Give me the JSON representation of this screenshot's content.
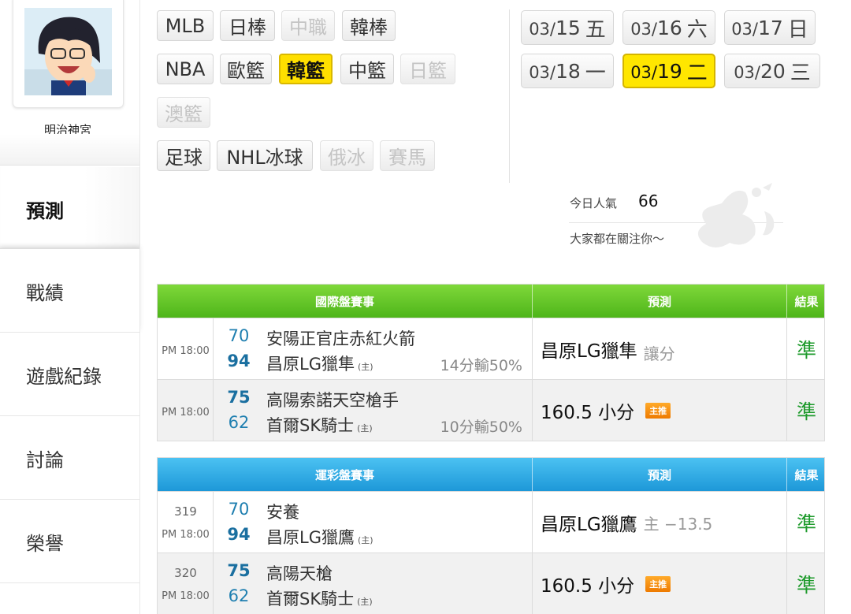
{
  "sidebar": {
    "username": "明治神宮",
    "nav": {
      "predict": "預測",
      "record": "戰績",
      "games": "遊戲紀錄",
      "discuss": "討論",
      "honor": "榮譽"
    }
  },
  "sports": [
    {
      "label": "MLB",
      "state": "normal"
    },
    {
      "label": "日棒",
      "state": "normal"
    },
    {
      "label": "中職",
      "state": "disabled"
    },
    {
      "label": "韓棒",
      "state": "normal"
    },
    {
      "label": "NBA",
      "state": "normal"
    },
    {
      "label": "歐籃",
      "state": "normal"
    },
    {
      "label": "韓籃",
      "state": "active"
    },
    {
      "label": "中籃",
      "state": "normal"
    },
    {
      "label": "日籃",
      "state": "disabled"
    },
    {
      "label": "澳籃",
      "state": "disabled"
    },
    {
      "label": "足球",
      "state": "normal"
    },
    {
      "label": "NHL冰球",
      "state": "normal"
    },
    {
      "label": "俄冰",
      "state": "disabled"
    },
    {
      "label": "賽馬",
      "state": "disabled"
    }
  ],
  "dates": [
    {
      "month": "03/",
      "day": "15",
      "weekday": "五"
    },
    {
      "month": "03/",
      "day": "16",
      "weekday": "六"
    },
    {
      "month": "03/",
      "day": "17",
      "weekday": "日"
    },
    {
      "month": "03/",
      "day": "18",
      "weekday": "一"
    },
    {
      "month": "03/",
      "day": "19",
      "weekday": "二"
    },
    {
      "month": "03/",
      "day": "20",
      "weekday": "三"
    }
  ],
  "selected_date_index": 4,
  "popularity": {
    "label": "今日人氣",
    "value": "66",
    "message": "大家都在關注你～"
  },
  "international": {
    "header": {
      "match": "國際盤賽事",
      "prediction": "預測",
      "result": "結果"
    },
    "rows": [
      {
        "time": "PM 18:00",
        "away_score": "70",
        "away_team": "安陽正官庄赤紅火箭",
        "home_score": "94",
        "home_team": "昌原LG獵隼",
        "home_tag": "(主)",
        "handicap": "14分輸50%",
        "prediction": "昌原LG獵隼",
        "prediction_sub": "讓分",
        "badge": "",
        "result": "準"
      },
      {
        "time": "PM 18:00",
        "away_score": "75",
        "away_team": "高陽索諾天空槍手",
        "home_score": "62",
        "home_team": "首爾SK騎士",
        "home_tag": "(主)",
        "handicap": "10分輸50%",
        "prediction": "160.5 小分",
        "prediction_sub": "",
        "badge": "主推",
        "result": "準"
      }
    ]
  },
  "lottery": {
    "header": {
      "match": "運彩盤賽事",
      "prediction": "預測",
      "result": "結果"
    },
    "rows": [
      {
        "number": "319",
        "time": "PM 18:00",
        "away_score": "70",
        "away_team": "安養",
        "home_score": "94",
        "home_team": "昌原LG獵鷹",
        "home_tag": "(主)",
        "handicap": "",
        "prediction": "昌原LG獵鷹",
        "prediction_sub": "主 −13.5",
        "badge": "",
        "result": "準"
      },
      {
        "number": "320",
        "time": "PM 18:00",
        "away_score": "75",
        "away_team": "高陽天槍",
        "home_score": "62",
        "home_team": "首爾SK騎士",
        "home_tag": "(主)",
        "handicap": "",
        "prediction": "160.5 小分",
        "prediction_sub": "",
        "badge": "主推",
        "result": "準"
      }
    ]
  },
  "colors": {
    "accent_yellow": "#ffe600",
    "green_header": "#5cc024",
    "blue_header": "#27a6e2",
    "result_green": "#1d9a2b",
    "score_blue": "#1f7fb0"
  }
}
